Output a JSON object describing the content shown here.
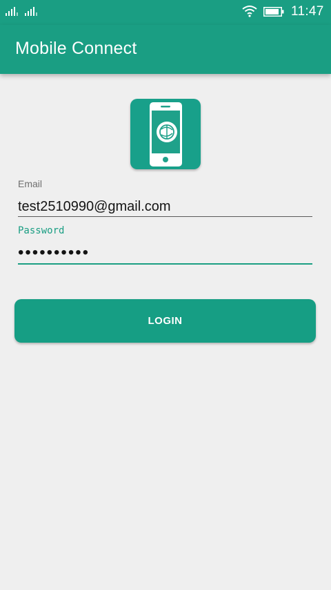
{
  "status_bar": {
    "time": "11:47",
    "icons": [
      "signal-icon",
      "signal-icon",
      "wifi-icon",
      "battery-icon"
    ]
  },
  "app_bar": {
    "title": "Mobile Connect"
  },
  "logo": {
    "icon": "phone-icon"
  },
  "form": {
    "email_label": "Email",
    "email_value": "test2510990@gmail.com",
    "password_label": "Password",
    "password_value": "••••••••••"
  },
  "login_button": {
    "label": "LOGIN"
  },
  "colors": {
    "primary": "#1a9e83",
    "background": "#efefef",
    "text": "#141414"
  }
}
